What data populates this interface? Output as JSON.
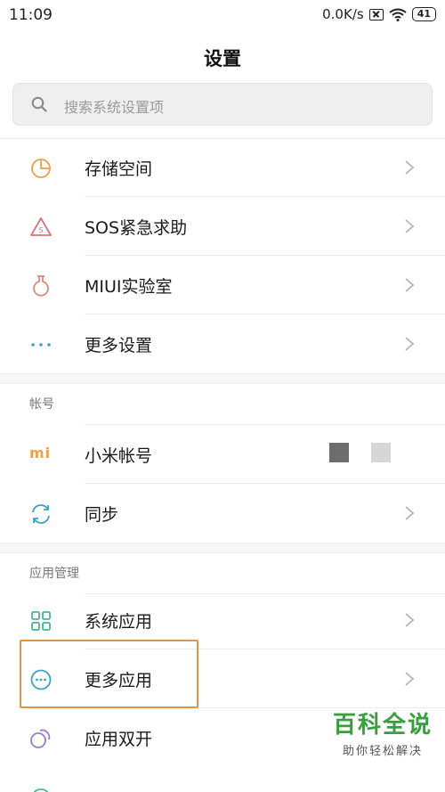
{
  "status": {
    "time": "11:09",
    "speed": "0.0K/s",
    "battery": "41"
  },
  "page": {
    "title": "设置"
  },
  "search": {
    "placeholder": "搜索系统设置项"
  },
  "group1": {
    "items": [
      {
        "label": "存储空间",
        "icon": "storage-pie-icon",
        "color": "#f0a04b"
      },
      {
        "label": "SOS紧急求助",
        "icon": "sos-triangle-icon",
        "color": "#e07070"
      },
      {
        "label": "MIUI实验室",
        "icon": "lab-flask-icon",
        "color": "#e08a7a"
      },
      {
        "label": "更多设置",
        "icon": "more-dots-icon",
        "color": "#3aa3c7"
      }
    ]
  },
  "account": {
    "header": "帐号",
    "items": [
      {
        "label": "小米帐号",
        "icon": "mi-logo-icon",
        "logo_text": "mi",
        "color": "#f0a04b"
      },
      {
        "label": "同步",
        "icon": "sync-icon",
        "color": "#3aa3c7"
      }
    ]
  },
  "apps": {
    "header": "应用管理",
    "items": [
      {
        "label": "系统应用",
        "icon": "grid-apps-icon",
        "color": "#49b591"
      },
      {
        "label": "更多应用",
        "icon": "more-circle-icon",
        "color": "#3aa3c7"
      },
      {
        "label": "应用双开",
        "icon": "dual-app-icon",
        "color": "#9a7ad6"
      }
    ]
  },
  "watermark": {
    "title": "百科全说",
    "subtitle": "助你轻松解决"
  }
}
